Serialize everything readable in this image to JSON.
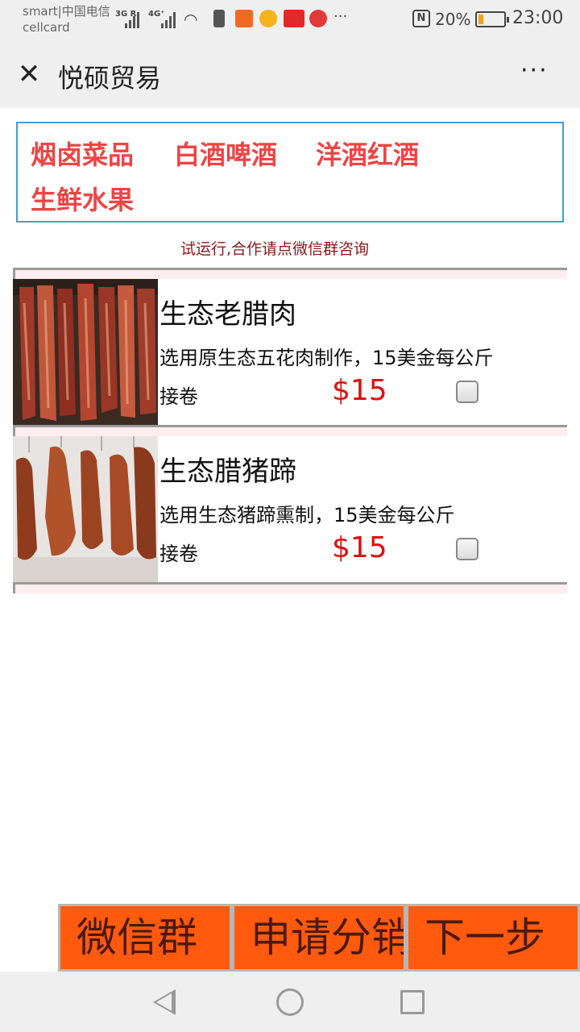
{
  "status_bar": {
    "carrier_line1": "smart|中国电信",
    "carrier_line2": "cellcard",
    "network1": "3G R",
    "network2": "4G⁺",
    "app_icons": [
      "中国移动",
      "flower-app",
      "TMALL",
      "pinwheel-app"
    ],
    "overflow": "···",
    "nfc": "N",
    "battery_percent": "20%",
    "battery_level": 0.2,
    "battery_color": "#f3a21a",
    "time": "23:00"
  },
  "titlebar": {
    "close_glyph": "✕",
    "title": "悦硕贸易",
    "more_glyph": "···"
  },
  "categories": [
    "烟卤菜品",
    "白酒啤酒",
    "洋酒红酒",
    "生鲜水果"
  ],
  "notice": "试运行,合作请点微信群咨询",
  "products": [
    {
      "name": "生态老腊肉",
      "desc": "选用原生态五花肉制作，15美金每公斤",
      "unit": "接卷",
      "price": "$15",
      "checked": false
    },
    {
      "name": "生态腊猪蹄",
      "desc": "选用生态猪蹄熏制，15美金每公斤",
      "unit": "接卷",
      "price": "$15",
      "checked": false
    }
  ],
  "actions": {
    "wechat_group": "微信群",
    "apply_distribution": "申请分销",
    "next_step": "下一步"
  },
  "colors": {
    "category_text": "#ee4444",
    "price": "#dd1111",
    "action_button": "#ff5a0e",
    "notice_text": "#8b1a1a"
  }
}
